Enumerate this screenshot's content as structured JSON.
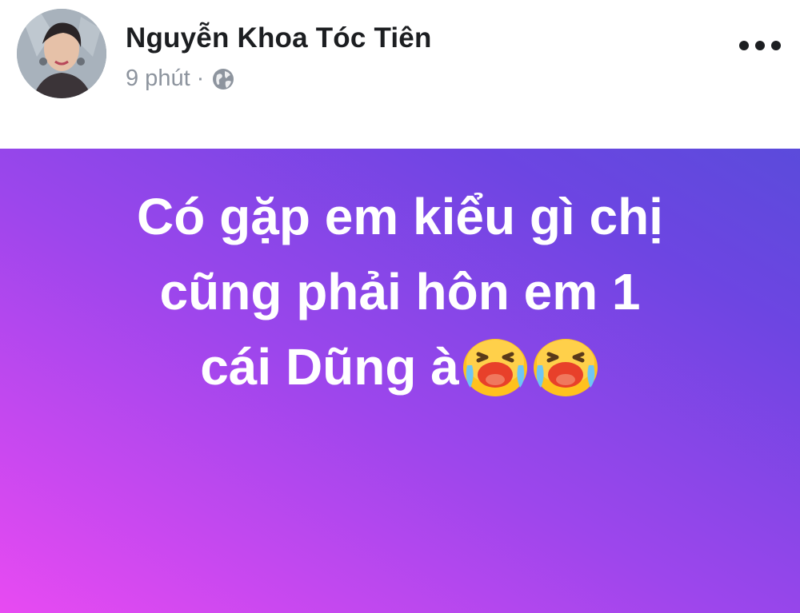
{
  "post": {
    "author": "Nguyễn Khoa Tóc Tiên",
    "time": "9 phút",
    "separator": "·",
    "privacy_icon": "globe-icon",
    "menu_icon": "more-horizontal-icon",
    "status_lines": [
      "Có gặp em kiểu gì chị",
      "cũng phải hôn em 1",
      "cái Dũng à"
    ],
    "emojis": [
      "loudly-crying-face-icon",
      "loudly-crying-face-icon"
    ],
    "colors": {
      "gradient_start": "#e84af2",
      "gradient_mid": "#9d46ec",
      "gradient_end": "#5b4bdb",
      "name_text": "#1c1e21",
      "meta_text": "#8d949e",
      "emoji_yellow": "#ffc11e",
      "emoji_mouth": "#e8402a"
    }
  }
}
